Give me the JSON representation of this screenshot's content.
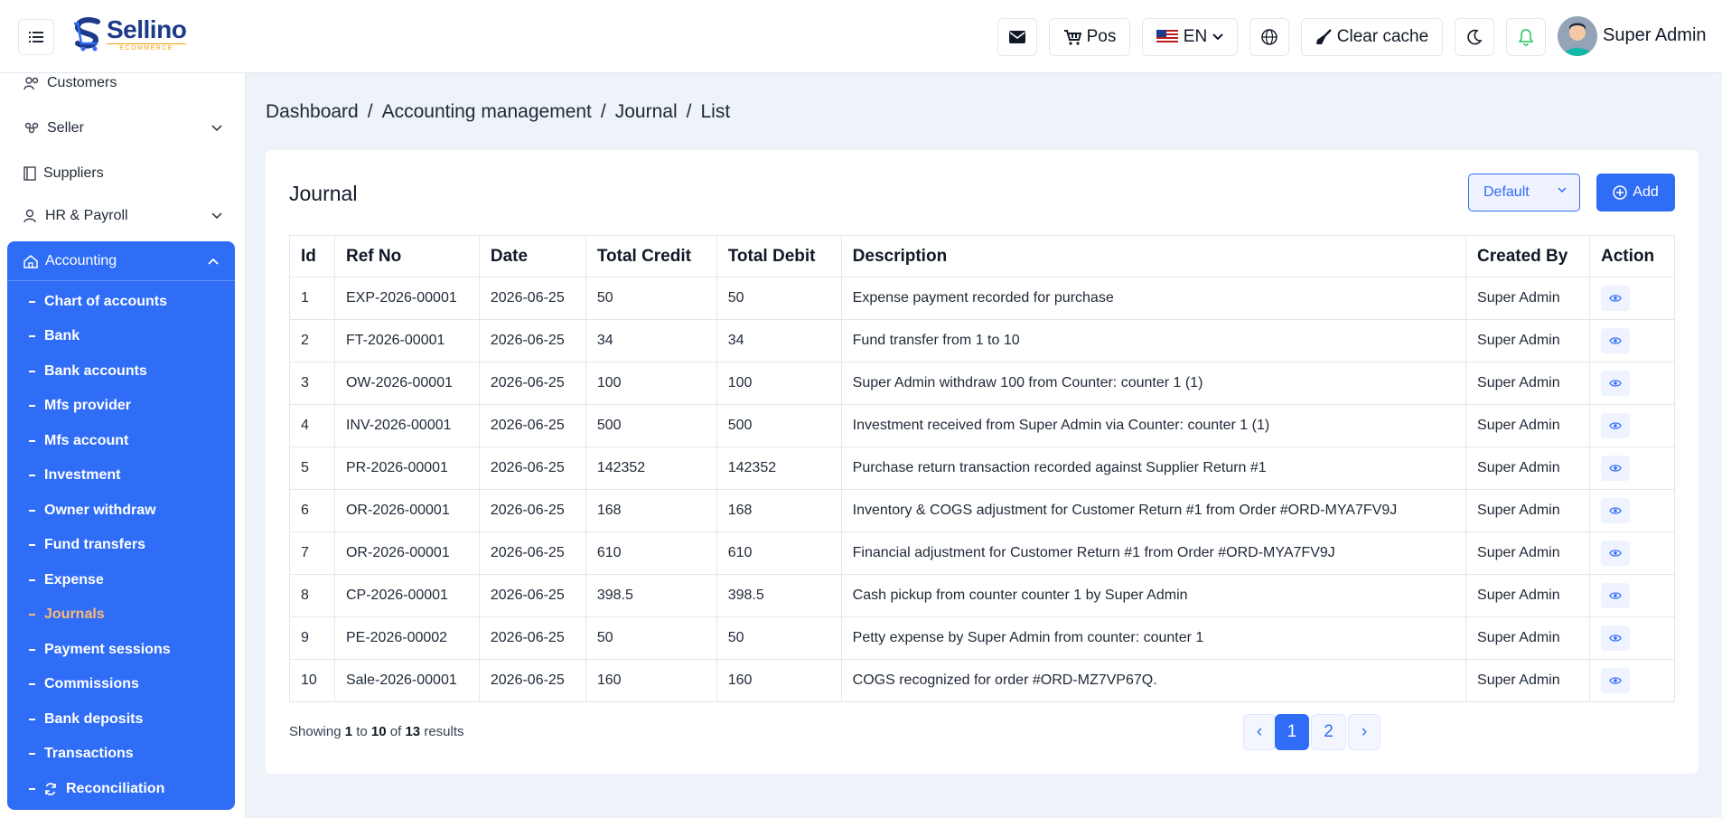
{
  "header": {
    "logo_name": "Sellino",
    "logo_sub": "ECOMMERCE",
    "pos_label": "Pos",
    "lang_label": "EN",
    "clear_cache_label": "Clear cache",
    "user_name": "Super Admin"
  },
  "sidebar": {
    "items": [
      {
        "label": "Customers"
      },
      {
        "label": "Seller"
      },
      {
        "label": "Suppliers"
      },
      {
        "label": "HR & Payroll"
      }
    ],
    "accounting": {
      "label": "Accounting",
      "subitems": [
        {
          "label": "Chart of accounts"
        },
        {
          "label": "Bank"
        },
        {
          "label": "Bank accounts"
        },
        {
          "label": "Mfs provider"
        },
        {
          "label": "Mfs account"
        },
        {
          "label": "Investment"
        },
        {
          "label": "Owner withdraw"
        },
        {
          "label": "Fund transfers"
        },
        {
          "label": "Expense"
        },
        {
          "label": "Journals"
        },
        {
          "label": "Payment sessions"
        },
        {
          "label": "Commissions"
        },
        {
          "label": "Bank deposits"
        },
        {
          "label": "Transactions"
        },
        {
          "label": "Reconciliation"
        }
      ],
      "active": "Journals"
    }
  },
  "breadcrumb": [
    "Dashboard",
    "/",
    "Accounting management",
    "/",
    "Journal",
    "/",
    "List"
  ],
  "card": {
    "title": "Journal",
    "select_value": "Default",
    "add_label": "Add"
  },
  "table": {
    "headers": [
      "Id",
      "Ref No",
      "Date",
      "Total Credit",
      "Total Debit",
      "Description",
      "Created By",
      "Action"
    ],
    "rows": [
      [
        "1",
        "EXP-2026-00001",
        "2026-06-25",
        "50",
        "50",
        "Expense payment recorded for purchase",
        "Super Admin"
      ],
      [
        "2",
        "FT-2026-00001",
        "2026-06-25",
        "34",
        "34",
        "Fund transfer from 1 to 10",
        "Super Admin"
      ],
      [
        "3",
        "OW-2026-00001",
        "2026-06-25",
        "100",
        "100",
        "Super Admin withdraw 100 from Counter: counter 1 (1)",
        "Super Admin"
      ],
      [
        "4",
        "INV-2026-00001",
        "2026-06-25",
        "500",
        "500",
        "Investment received from Super Admin via Counter: counter 1 (1)",
        "Super Admin"
      ],
      [
        "5",
        "PR-2026-00001",
        "2026-06-25",
        "142352",
        "142352",
        "Purchase return transaction recorded against Supplier Return #1",
        "Super Admin"
      ],
      [
        "6",
        "OR-2026-00001",
        "2026-06-25",
        "168",
        "168",
        "Inventory & COGS adjustment for Customer Return #1 from Order #ORD-MYA7FV9J",
        "Super Admin"
      ],
      [
        "7",
        "OR-2026-00001",
        "2026-06-25",
        "610",
        "610",
        "Financial adjustment for Customer Return #1 from Order #ORD-MYA7FV9J",
        "Super Admin"
      ],
      [
        "8",
        "CP-2026-00001",
        "2026-06-25",
        "398.5",
        "398.5",
        "Cash pickup from counter counter 1 by Super Admin",
        "Super Admin"
      ],
      [
        "9",
        "PE-2026-00002",
        "2026-06-25",
        "50",
        "50",
        "Petty expense by Super Admin from counter: counter 1",
        "Super Admin"
      ],
      [
        "10",
        "Sale-2026-00001",
        "2026-06-25",
        "160",
        "160",
        "COGS recognized for order #ORD-MZ7VP67Q.",
        "Super Admin"
      ]
    ]
  },
  "pagination": {
    "showing_prefix": "Showing",
    "from": "1",
    "to_word": "to",
    "to": "10",
    "of_word": "of",
    "total": "13",
    "results_word": "results",
    "prev": "‹",
    "pages": [
      "1",
      "2"
    ],
    "next": "›",
    "current": "1"
  },
  "colors": {
    "primary": "#2f6df6",
    "active_menu": "#fdba74",
    "background": "#eef2f9"
  }
}
